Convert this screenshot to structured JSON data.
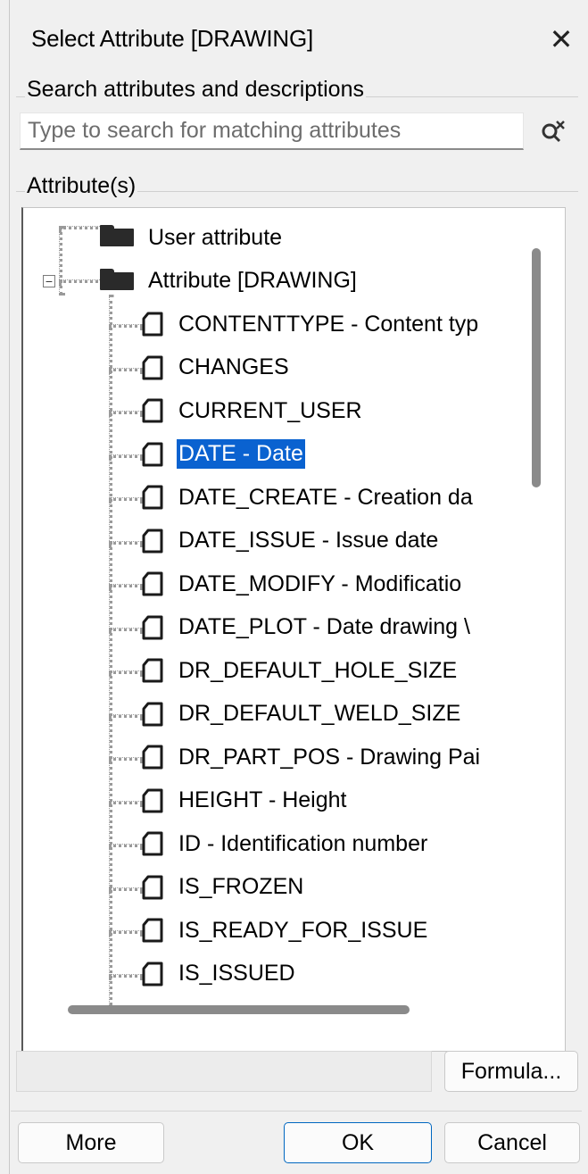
{
  "dialog": {
    "title": "Select Attribute [DRAWING]",
    "close_symbol": "✕"
  },
  "search": {
    "legend": "Search attributes and descriptions",
    "placeholder": "Type to search for matching attributes",
    "value": ""
  },
  "attributes": {
    "legend": "Attribute(s)",
    "roots": [
      {
        "label": "User attribute",
        "expander": ""
      },
      {
        "label": "Attribute [DRAWING]",
        "expander": "−"
      }
    ],
    "items": [
      {
        "label": "CONTENTTYPE  -  Content typ",
        "selected": false
      },
      {
        "label": "CHANGES",
        "selected": false
      },
      {
        "label": "CURRENT_USER",
        "selected": false
      },
      {
        "label": "DATE  -  Date",
        "selected": true
      },
      {
        "label": "DATE_CREATE  -  Creation da",
        "selected": false
      },
      {
        "label": "DATE_ISSUE  -  Issue date",
        "selected": false
      },
      {
        "label": "DATE_MODIFY  -  Modificatio",
        "selected": false
      },
      {
        "label": "DATE_PLOT  -  Date drawing \\",
        "selected": false
      },
      {
        "label": "DR_DEFAULT_HOLE_SIZE",
        "selected": false
      },
      {
        "label": "DR_DEFAULT_WELD_SIZE",
        "selected": false
      },
      {
        "label": "DR_PART_POS  -  Drawing Pai",
        "selected": false
      },
      {
        "label": "HEIGHT  -  Height",
        "selected": false
      },
      {
        "label": "ID  -  Identification number",
        "selected": false
      },
      {
        "label": "IS_FROZEN",
        "selected": false
      },
      {
        "label": "IS_READY_FOR_ISSUE",
        "selected": false
      },
      {
        "label": "IS_ISSUED",
        "selected": false
      }
    ]
  },
  "buttons": {
    "formula": "Formula...",
    "more": "More",
    "ok": "OK",
    "cancel": "Cancel"
  },
  "colors": {
    "selection": "#0a62d0",
    "primary_border": "#0067c0"
  },
  "icons": {
    "close": "close-icon",
    "search": "search-clear-icon",
    "folder": "folder-icon",
    "document": "document-icon"
  }
}
